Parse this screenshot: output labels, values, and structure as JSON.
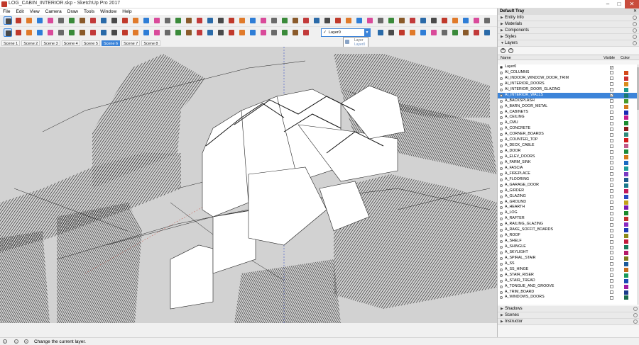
{
  "window": {
    "title": "LOG_CABIN_INTERIOR.skp - SketchUp Pro 2017",
    "minimize": "–",
    "maximize": "□",
    "close": "✕"
  },
  "menu": [
    "File",
    "Edit",
    "View",
    "Camera",
    "Draw",
    "Tools",
    "Window",
    "Help"
  ],
  "layer_selector": {
    "current": "Layer0",
    "popup_title": "Layer",
    "popup_value": "Layer0"
  },
  "scenes": [
    "Scene 1",
    "Scene 2",
    "Scene 3",
    "Scene 4",
    "Scene 5",
    "Scene 6",
    "Scene 7",
    "Scene 8"
  ],
  "active_scene": "Scene 6",
  "tray": {
    "title": "Default Tray",
    "close": "✕",
    "panels_top": [
      "Entity Info",
      "Materials",
      "Components",
      "Styles"
    ],
    "layers_panel": "Layers",
    "add_layer": "+",
    "remove_layer": "−",
    "columns": {
      "name": "Name",
      "visible": "Visible",
      "color": "Color"
    },
    "panels_bottom": [
      "Shadows",
      "Scenes",
      "Instructor"
    ]
  },
  "layers": [
    {
      "name": "Layer0",
      "current": true,
      "visible": true,
      "color": ""
    },
    {
      "name": "AI_COLUMNS",
      "visible": false,
      "color": "#d44a1a"
    },
    {
      "name": "AI_INDOOR_WINDOW_DOOR_TRIM",
      "visible": false,
      "color": "#cc2e2e"
    },
    {
      "name": "AI_INTERIOR_DOORS",
      "visible": false,
      "color": "#d98c1a"
    },
    {
      "name": "AI_INTERIOR_DOOR_GLAZING",
      "visible": false,
      "color": "#1a9a8c"
    },
    {
      "name": "AI_INTERIOR_WALLS",
      "visible": true,
      "color": "#1a7a6e",
      "selected": true
    },
    {
      "name": "A_BACKSPLASH",
      "visible": false,
      "color": "#4a9a2a"
    },
    {
      "name": "A_BARN_DOOR_METAL",
      "visible": false,
      "color": "#d47a1a"
    },
    {
      "name": "A_CABINETS",
      "visible": false,
      "color": "#1a2ab4"
    },
    {
      "name": "A_CEILING",
      "visible": false,
      "color": "#c21a8c"
    },
    {
      "name": "A_CMU",
      "visible": false,
      "color": "#1a8c2e"
    },
    {
      "name": "A_CONCRETE",
      "visible": false,
      "color": "#8c1a1a"
    },
    {
      "name": "A_CORNER_BOARDS",
      "visible": false,
      "color": "#2e8a7a"
    },
    {
      "name": "A_COUNTER_TOP",
      "visible": false,
      "color": "#d41a1a"
    },
    {
      "name": "A_DECK_CABLE",
      "visible": false,
      "color": "#c25a8a"
    },
    {
      "name": "A_DOOR",
      "visible": false,
      "color": "#1a8a3a"
    },
    {
      "name": "A_ELEV_DOORS",
      "visible": false,
      "color": "#d47a1a"
    },
    {
      "name": "A_FARM_SINK",
      "visible": false,
      "color": "#1a6ac2"
    },
    {
      "name": "A_FASCIA",
      "visible": false,
      "color": "#1a9a9a"
    },
    {
      "name": "A_FIREPLACE",
      "visible": false,
      "color": "#7a3ac2"
    },
    {
      "name": "A_FLOORING",
      "visible": false,
      "color": "#1a5a8a"
    },
    {
      "name": "A_GARAGE_DOOR",
      "visible": false,
      "color": "#1a7a8c"
    },
    {
      "name": "A_GIRDER",
      "visible": false,
      "color": "#c21a5a"
    },
    {
      "name": "A_GLAZING",
      "visible": false,
      "color": "#2a4ac2"
    },
    {
      "name": "A_GROUND",
      "visible": false,
      "color": "#c2a21a"
    },
    {
      "name": "A_HEARTH",
      "visible": false,
      "color": "#7a1ab4"
    },
    {
      "name": "A_LOG",
      "visible": false,
      "color": "#1a8a2a"
    },
    {
      "name": "A_RAFTER",
      "visible": false,
      "color": "#c22e2e"
    },
    {
      "name": "A_RAILING_GLAZING",
      "visible": false,
      "color": "#8a2ac2"
    },
    {
      "name": "A_RAKE_SOFFIT_BOARDS",
      "visible": false,
      "color": "#1a3ab4"
    },
    {
      "name": "A_ROOF",
      "visible": false,
      "color": "#8a8a1a"
    },
    {
      "name": "A_SHELF",
      "visible": false,
      "color": "#c21a3a"
    },
    {
      "name": "A_SHINGLE",
      "visible": false,
      "color": "#1a7a5a"
    },
    {
      "name": "A_SKYLIGHT",
      "visible": false,
      "color": "#b41a6a"
    },
    {
      "name": "A_SPIRAL_STAIR",
      "visible": false,
      "color": "#7a7a1a"
    },
    {
      "name": "A_SS",
      "visible": false,
      "color": "#1a5a9a"
    },
    {
      "name": "A_SS_HINGE",
      "visible": false,
      "color": "#c26a1a"
    },
    {
      "name": "A_STAIR_RISER",
      "visible": false,
      "color": "#1a9a5a"
    },
    {
      "name": "A_STAIR_TREAD",
      "visible": false,
      "color": "#1a4ab4"
    },
    {
      "name": "A_TONGUE_AND_GROOVE",
      "visible": false,
      "color": "#a21aa2"
    },
    {
      "name": "A_TRIM_BOARD",
      "visible": false,
      "color": "#1a3a8a"
    },
    {
      "name": "A_WINDOWS_DOORS",
      "visible": false,
      "color": "#1a6a4a"
    }
  ],
  "status": {
    "text": "Change the current layer."
  },
  "colors": {
    "accent": "#3c84d9",
    "viewport_bg": "#d2d2d2",
    "close_btn": "#c94c3d"
  }
}
